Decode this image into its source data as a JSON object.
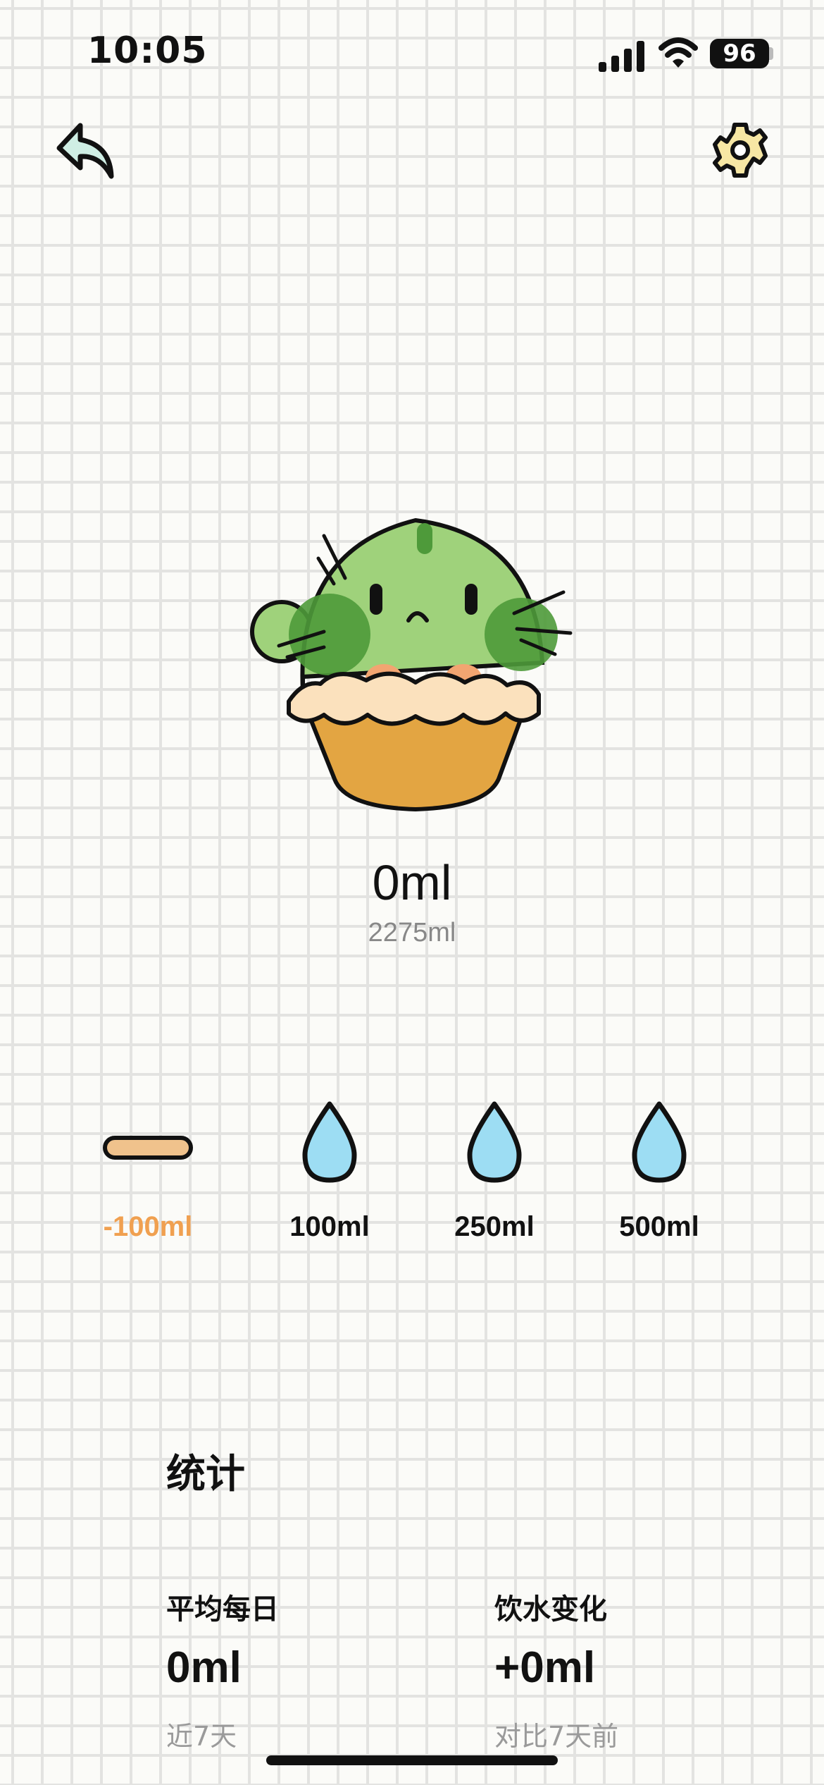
{
  "status_bar": {
    "time": "10:05",
    "battery": "96",
    "icons": [
      "signal-icon",
      "wifi-icon",
      "battery-icon"
    ]
  },
  "nav": {
    "back_icon": "undo-arrow-icon",
    "settings_icon": "gear-icon"
  },
  "colors": {
    "background": "#fbfbf8",
    "grid": "#e3e3e1",
    "accent_orange": "#f0a050",
    "water_blue": "#9dddf3",
    "cactus_green": "#9fd27b",
    "pot_orange": "#e3a542"
  },
  "water": {
    "current": "0ml",
    "goal": "2275ml"
  },
  "quick_add": [
    {
      "label": "-100ml",
      "icon": "minus-bar-icon"
    },
    {
      "label": "100ml",
      "icon": "water-drop-icon"
    },
    {
      "label": "250ml",
      "icon": "water-drop-icon"
    },
    {
      "label": "500ml",
      "icon": "water-drop-icon"
    }
  ],
  "stats": {
    "title": "统计",
    "average": {
      "label": "平均每日",
      "value": "0ml",
      "sub": "近7天"
    },
    "change": {
      "label": "饮水变化",
      "value": "+0ml",
      "sub": "对比7天前"
    }
  }
}
